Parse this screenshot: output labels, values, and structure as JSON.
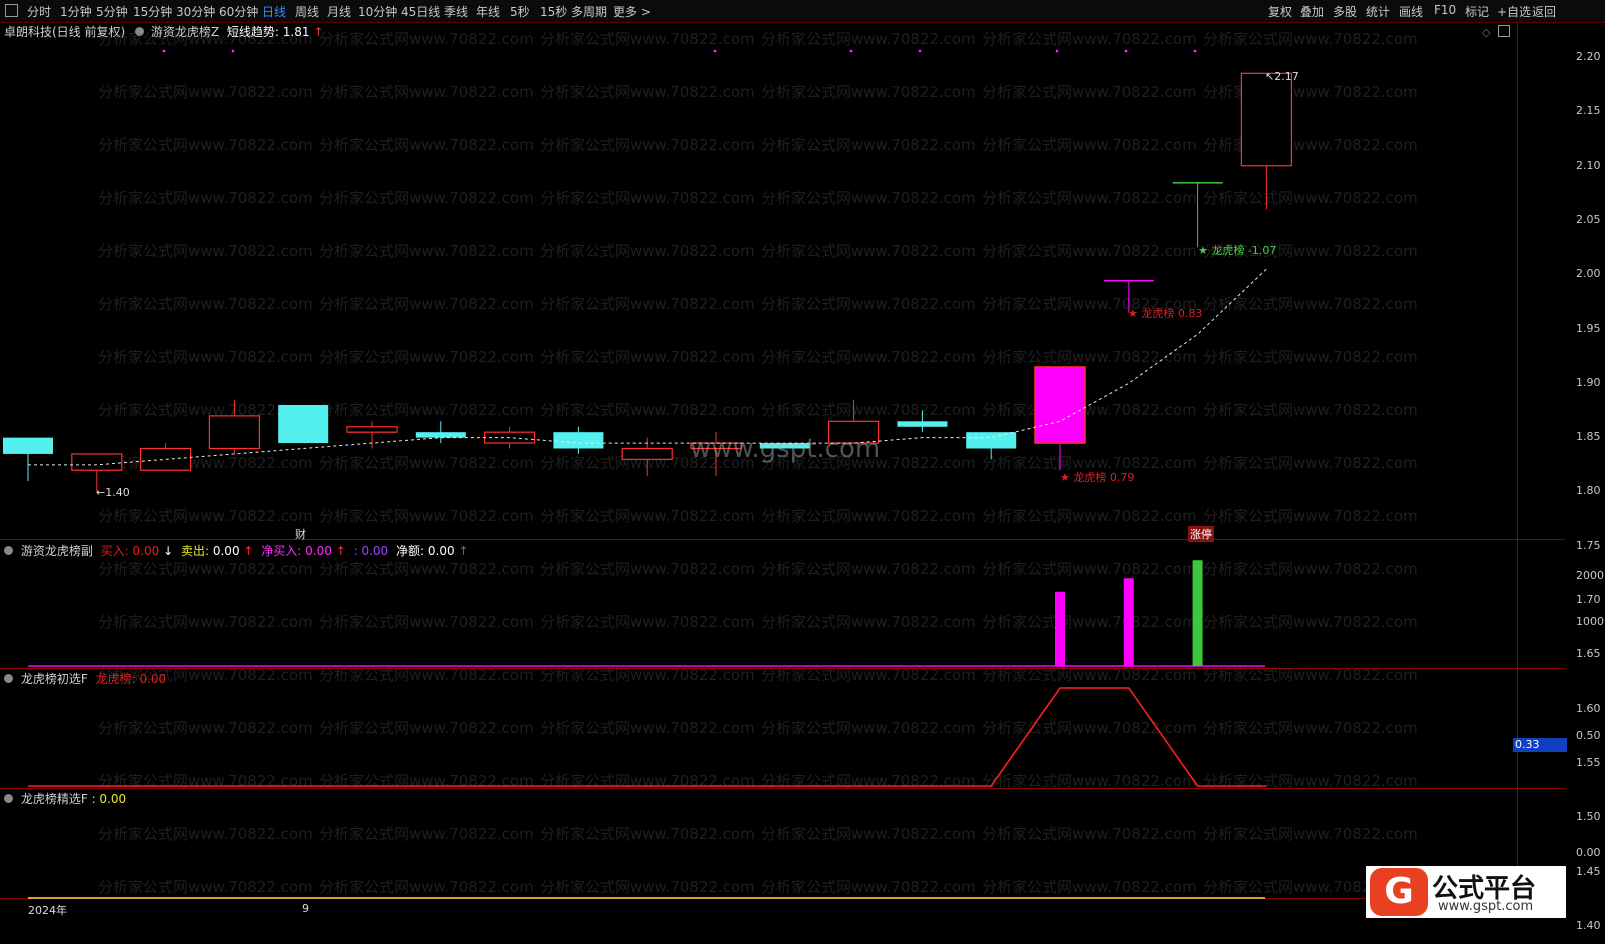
{
  "toolbar": {
    "window_icon": "window-icon",
    "periods": [
      "分时",
      "1分钟",
      "5分钟",
      "15分钟",
      "30分钟",
      "60分钟",
      "日线",
      "周线",
      "月线",
      "10分钟",
      "45日线",
      "季线",
      "年线",
      "5秒",
      "15秒",
      "多周期",
      "更多 >"
    ],
    "active_period": "日线",
    "tools": [
      "复权",
      "叠加",
      "多股",
      "统计",
      "画线",
      "F10",
      "标记",
      "+自选",
      "返回"
    ]
  },
  "main_panel": {
    "stock_name": "卓朗科技(日线 前复权)",
    "indicator_name": "游资龙虎榜Z",
    "trend_label": "短线趋势:",
    "trend_value": "1.81",
    "trend_arrow": "↑",
    "high_label": "2.17",
    "low_label": "1.40",
    "watermark_center": "www.gspt.com",
    "watermark_repeat": "分析家公式网www.70822.com",
    "finance_marker": "财",
    "limit_up_marker": "涨停",
    "annotations": [
      {
        "text": "★ 龙虎榜 -1.07",
        "color": "#4ec94e"
      },
      {
        "text": "★ 龙虎榜 0.83",
        "color": "#e02020"
      },
      {
        "text": "★ 龙虎榜 0.79",
        "color": "#e02020"
      }
    ],
    "y_axis": [
      "2.20",
      "2.15",
      "2.10",
      "2.05",
      "2.00",
      "1.95",
      "1.90",
      "1.85",
      "1.80",
      "1.75",
      "1.70",
      "1.65",
      "1.60",
      "1.55",
      "1.50",
      "1.45",
      "1.40"
    ]
  },
  "panel2": {
    "title": "游资龙虎榜副",
    "buy_label": "买入:",
    "buy_value": "0.00",
    "buy_arrow": "↓",
    "sell_label": "卖出:",
    "sell_value": "0.00",
    "sell_arrow": "↑",
    "netbuy_label": "净买入:",
    "netbuy_value": "0.00",
    "netbuy_arrow": "↑",
    "colon_value": ": 0.00",
    "net_label": "净额:",
    "net_value": "0.00",
    "net_arrow": "↑",
    "y_axis": [
      "2000",
      "1000"
    ]
  },
  "panel3": {
    "title": "龙虎榜初选F",
    "item_label": "龙虎榜:",
    "item_value": "0.00",
    "y_axis": [
      "0.50"
    ],
    "current_badge": "0.33"
  },
  "panel4": {
    "title": "龙虎榜精选F",
    "item_value": ": 0.00",
    "y_axis": [
      "0.00"
    ]
  },
  "timeline": {
    "year_label": "2024年",
    "month_label": "9"
  },
  "logo": {
    "name": "公式平台",
    "url": "www.gspt.com"
  },
  "chart_data": {
    "type": "candlestick",
    "ylim": [
      1.35,
      2.22
    ],
    "candles": [
      {
        "o": 1.47,
        "h": 1.5,
        "l": 1.42,
        "c": 1.5,
        "color": "cyan"
      },
      {
        "o": 1.44,
        "h": 1.47,
        "l": 1.4,
        "c": 1.47,
        "color": "red"
      },
      {
        "o": 1.44,
        "h": 1.49,
        "l": 1.44,
        "c": 1.48,
        "color": "red"
      },
      {
        "o": 1.48,
        "h": 1.57,
        "l": 1.47,
        "c": 1.54,
        "color": "red"
      },
      {
        "o": 1.56,
        "h": 1.56,
        "l": 1.49,
        "c": 1.49,
        "color": "cyan"
      },
      {
        "o": 1.51,
        "h": 1.53,
        "l": 1.48,
        "c": 1.52,
        "color": "red"
      },
      {
        "o": 1.51,
        "h": 1.53,
        "l": 1.49,
        "c": 1.5,
        "color": "cyan"
      },
      {
        "o": 1.49,
        "h": 1.52,
        "l": 1.48,
        "c": 1.51,
        "color": "red"
      },
      {
        "o": 1.51,
        "h": 1.52,
        "l": 1.47,
        "c": 1.48,
        "color": "cyan"
      },
      {
        "o": 1.46,
        "h": 1.5,
        "l": 1.43,
        "c": 1.48,
        "color": "red"
      },
      {
        "o": 1.48,
        "h": 1.51,
        "l": 1.43,
        "c": 1.49,
        "color": "red"
      },
      {
        "o": 1.49,
        "h": 1.49,
        "l": 1.48,
        "c": 1.48,
        "color": "cyan"
      },
      {
        "o": 1.49,
        "h": 1.57,
        "l": 1.49,
        "c": 1.53,
        "color": "red"
      },
      {
        "o": 1.53,
        "h": 1.55,
        "l": 1.51,
        "c": 1.52,
        "color": "cyan"
      },
      {
        "o": 1.51,
        "h": 1.51,
        "l": 1.46,
        "c": 1.48,
        "color": "cyan"
      },
      {
        "o": 1.49,
        "h": 1.63,
        "l": 1.44,
        "c": 1.63,
        "color": "magenta"
      },
      {
        "o": 1.79,
        "h": 1.79,
        "l": 1.73,
        "c": 1.79,
        "color": "magenta"
      },
      {
        "o": 1.97,
        "h": 1.97,
        "l": 1.85,
        "c": 1.97,
        "color": "green"
      },
      {
        "o": 2.0,
        "h": 2.17,
        "l": 1.92,
        "c": 2.17,
        "color": "red"
      }
    ],
    "trend_line": [
      1.45,
      1.45,
      1.46,
      1.47,
      1.48,
      1.49,
      1.5,
      1.5,
      1.49,
      1.49,
      1.49,
      1.49,
      1.49,
      1.5,
      1.5,
      1.53,
      1.6,
      1.69,
      1.81
    ],
    "panel2_bars": [
      0,
      0,
      0,
      0,
      0,
      0,
      0,
      0,
      0,
      0,
      0,
      0,
      0,
      0,
      0,
      1650,
      1950,
      2350,
      0
    ],
    "panel2_bar_colors": [
      "#ff00ff",
      "#ff00ff",
      "#ff00ff",
      "#ff00ff",
      "#ff00ff",
      "#ff00ff",
      "#ff00ff",
      "#ff00ff",
      "#ff00ff",
      "#ff00ff",
      "#ff00ff",
      "#ff00ff",
      "#ff00ff",
      "#ff00ff",
      "#ff00ff",
      "#ff00ff",
      "#ff00ff",
      "#3cc83c",
      "#ff00ff"
    ],
    "panel3_line": [
      0,
      0,
      0,
      0,
      0,
      0,
      0,
      0,
      0,
      0,
      0,
      0,
      0,
      0,
      0,
      1,
      1,
      0,
      0
    ]
  }
}
